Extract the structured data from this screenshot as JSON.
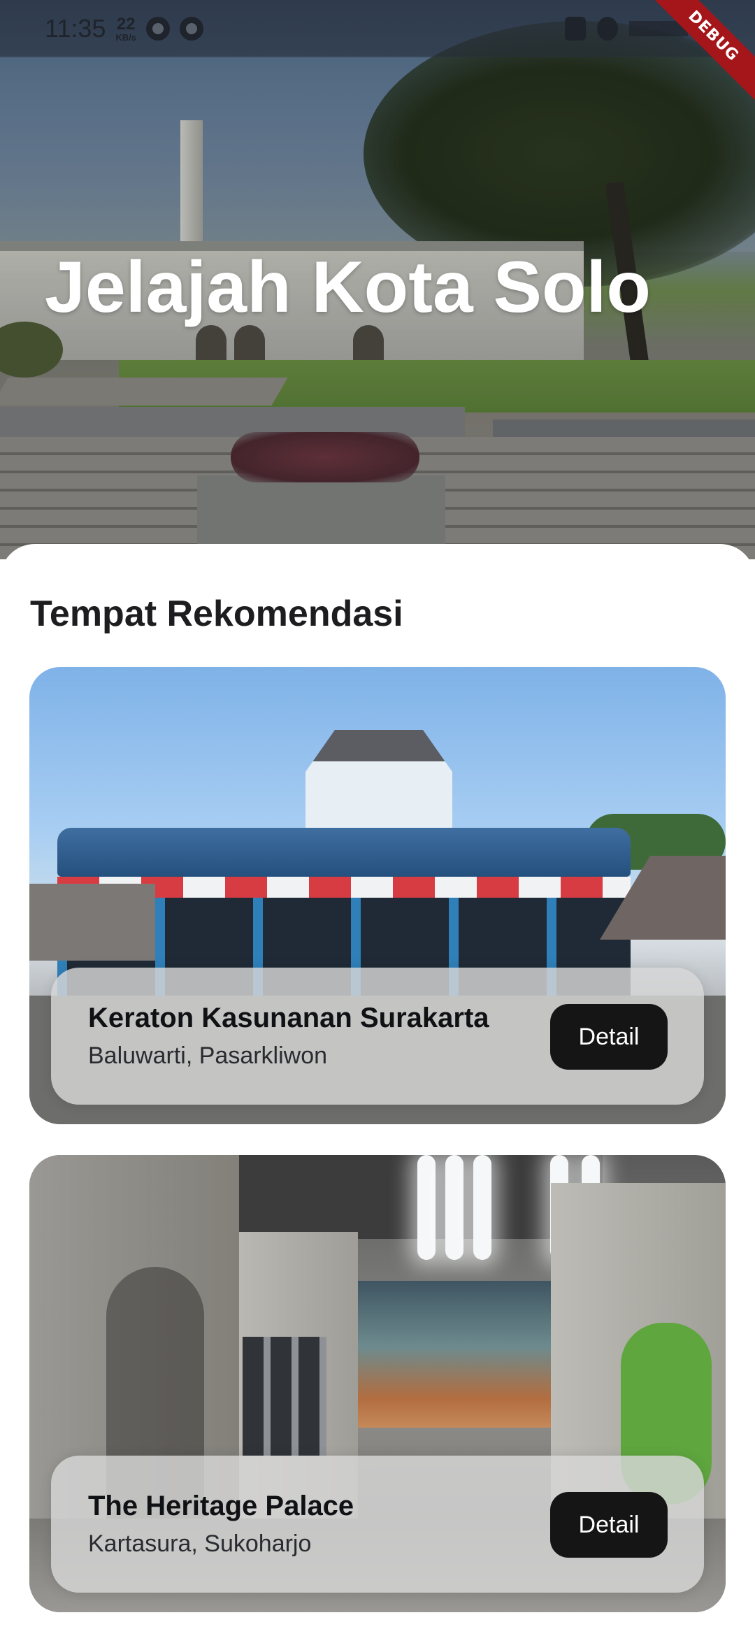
{
  "status_bar": {
    "time": "11:35",
    "net_speed_value": "22",
    "net_speed_unit": "KB/s"
  },
  "debug_banner": "DEBUG",
  "hero": {
    "title": "Jelajah Kota Solo"
  },
  "section": {
    "title": "Tempat Rekomendasi"
  },
  "places": [
    {
      "name": "Keraton Kasunanan Surakarta",
      "location": "Baluwarti, Pasarkliwon",
      "button_label": "Detail"
    },
    {
      "name": "The Heritage Palace",
      "location": "Kartasura, Sukoharjo",
      "button_label": "Detail"
    }
  ],
  "colors": {
    "button_bg": "#151515",
    "debug_ribbon": "#a4161a"
  },
  "icons": [
    "network-speed-icon",
    "globe-icon",
    "app-notification-icon",
    "lock-icon",
    "search-icon",
    "signal-icon"
  ]
}
